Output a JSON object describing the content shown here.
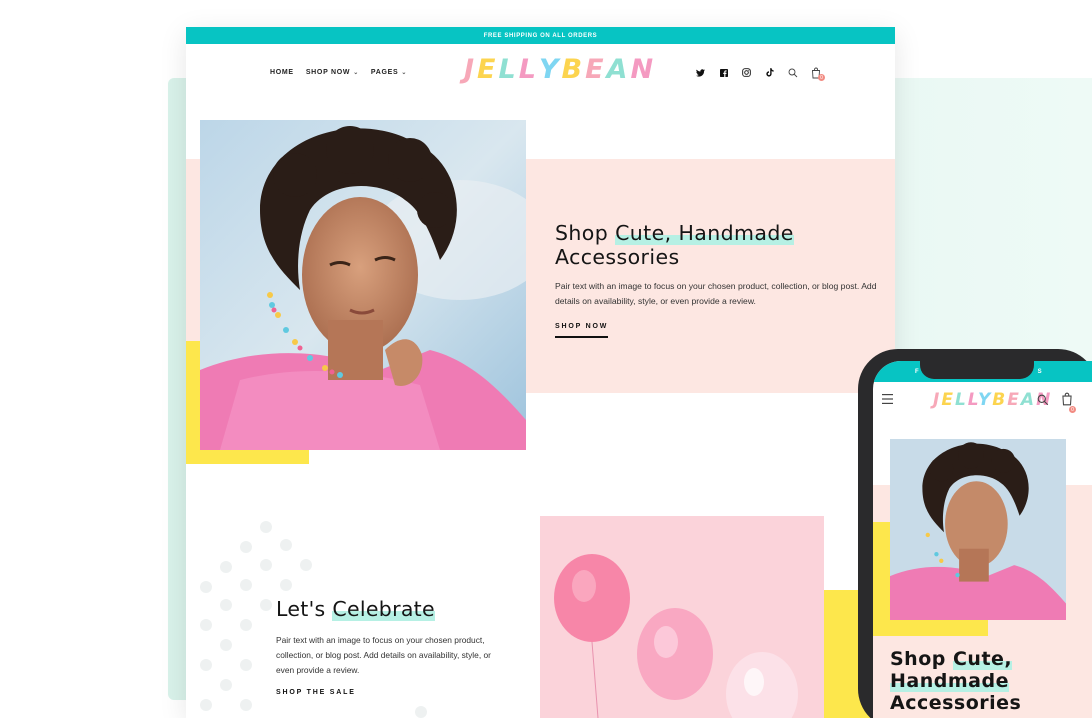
{
  "promo": {
    "text": "FREE SHIPPING ON ALL ORDERS"
  },
  "nav": {
    "home": "HOME",
    "shop_now": "SHOP NOW",
    "pages": "PAGES"
  },
  "brand": {
    "logo": "JELLYBEAN",
    "logo_colors": [
      "#f7a8b8",
      "#fcd44f",
      "#8fe0d2",
      "#f49ac1",
      "#7fd6f2",
      "#fcd44f",
      "#f7a8b8",
      "#8fe0d2",
      "#f49ac1"
    ]
  },
  "header_icons": [
    "twitter-icon",
    "facebook-icon",
    "instagram-icon",
    "tiktok-icon",
    "search-icon",
    "cart-icon"
  ],
  "cart": {
    "count": "0"
  },
  "hero": {
    "title_line1_a": "Shop ",
    "title_line1_b": "Cute, Handmade",
    "title_line2": "Accessories",
    "description": "Pair text with an image to focus on your chosen product, collection, or blog post. Add details on availability, style, or even provide a review.",
    "cta": "SHOP NOW"
  },
  "celebrate": {
    "title_a": "Let's ",
    "title_b": "Celebrate",
    "description": "Pair text with an image to focus on your chosen product, collection, or blog post. Add details on availability, style, or even provide a review.",
    "cta": "SHOP THE SALE"
  },
  "mobile": {
    "promo_partial_left": "F",
    "promo_partial_right": "S",
    "logo": "JELLYBEAN",
    "cart_count": "0",
    "title_line1_a": "Shop ",
    "title_line1_b": "Cute,",
    "title_line2": "Handmade",
    "title_line3": "Accessories"
  },
  "colors": {
    "accent_teal": "#07c4c3",
    "pink": "#fde7e2",
    "yellow": "#fde74c",
    "mint": "#b6f0e4"
  }
}
